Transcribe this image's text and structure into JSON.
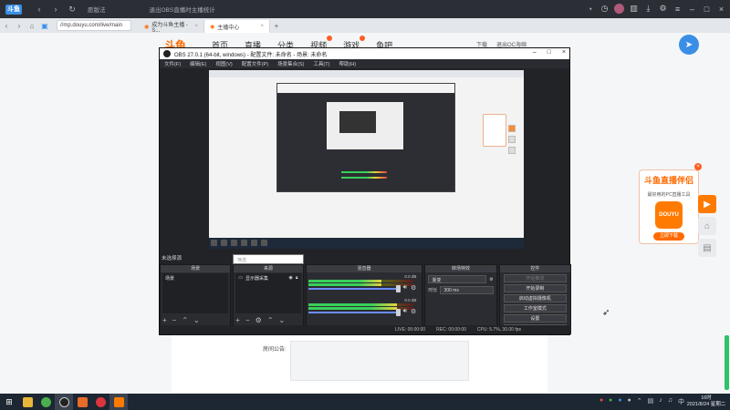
{
  "browser": {
    "badge": "斗鱼",
    "topbar_text": [
      "愿版法",
      "退出OBS直播时主播统计"
    ],
    "url": "//mp.douyu.com/live/main",
    "tabs": [
      {
        "label": "成为斗鱼主播 - S..."
      },
      {
        "label": "主播中心"
      }
    ]
  },
  "site": {
    "logo": "斗鱼",
    "nav": [
      "首页",
      "直播",
      "分类",
      "视频",
      "游戏",
      "鱼吧"
    ],
    "right": [
      "下载",
      "退出OC海绵"
    ],
    "room_label": "房间公告:"
  },
  "promo": {
    "title": "斗鱼直播伴侣",
    "subtitle": "最好用的PC直播工具",
    "app_label": "DOUYU",
    "button": "立即下载"
  },
  "obs": {
    "title": "OBS 27.0.1 (64-bit, windows) - 配置文件: 未命名 - 场景: 未命名",
    "menu": [
      "文件(F)",
      "编辑(E)",
      "视图(V)",
      "配置文件(P)",
      "场景集合(S)",
      "工具(T)",
      "帮助(H)"
    ],
    "no_source": "未选择源",
    "filter_placeholder": "筛选",
    "docks": {
      "scenes": {
        "title": "场景",
        "items": [
          "场景"
        ]
      },
      "sources": {
        "title": "来源",
        "items": [
          "显示器采集"
        ]
      },
      "mixer": {
        "title": "混音器",
        "rows": [
          {
            "db": "0.0 dB",
            "level": 0.7
          },
          {
            "db": "0.0 dB",
            "level": 0.85
          }
        ]
      },
      "transitions": {
        "title": "转场特效",
        "type": "渐变",
        "duration_label": "时长",
        "duration": "300 ms"
      },
      "controls": {
        "title": "控件",
        "buttons": [
          "开始推流",
          "开始录制",
          "启动虚拟摄像机",
          "工作室模式",
          "设置",
          "退出"
        ]
      }
    },
    "status": [
      "LIVE: 00:00:00",
      "REC: 00:00:00",
      "CPU: 5.7%, 30.00 fps"
    ]
  },
  "taskbar": {
    "time": "16时",
    "date": "2021/8/24 星期二"
  }
}
